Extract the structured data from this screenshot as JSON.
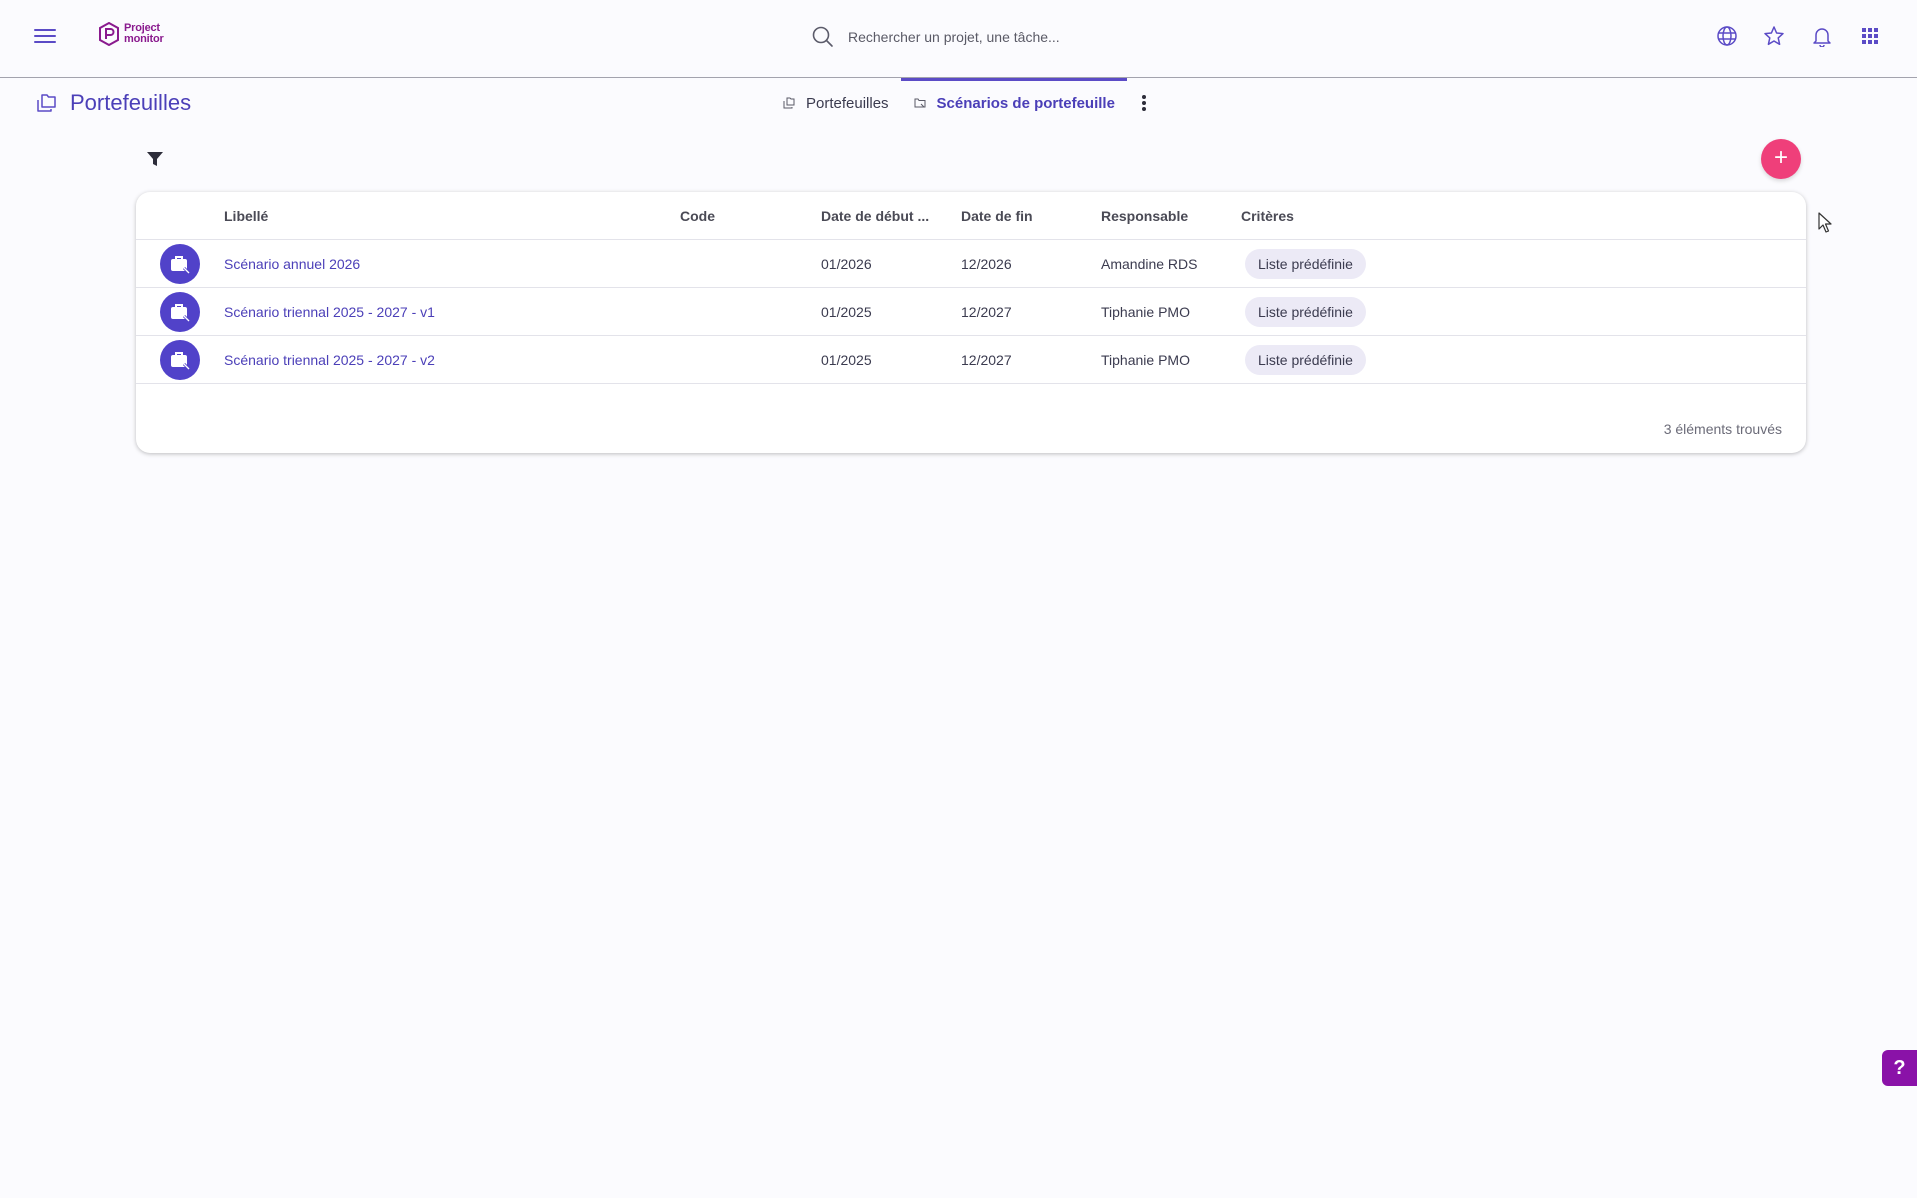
{
  "app": {
    "logo_line1": "Project",
    "logo_line2": "monitor"
  },
  "search": {
    "placeholder": "Rechercher un projet, une tâche..."
  },
  "topbar": {
    "icons": [
      "globe-icon",
      "star-icon",
      "bell-icon",
      "apps-grid-icon"
    ]
  },
  "page": {
    "title": "Portefeuilles"
  },
  "tabs": [
    {
      "label": "Portefeuilles",
      "active": false
    },
    {
      "label": "Scénarios de portefeuille",
      "active": true
    }
  ],
  "actions": {
    "add_label": "+"
  },
  "table": {
    "columns": [
      "Libellé",
      "Code",
      "Date de début ...",
      "Date de fin",
      "Responsable",
      "Critères"
    ],
    "rows": [
      {
        "label": "Scénario annuel 2026",
        "code": "",
        "start": "01/2026",
        "end": "12/2026",
        "owner": "Amandine RDS",
        "criteria": "Liste prédéfinie"
      },
      {
        "label": "Scénario triennal 2025 - 2027 - v1",
        "code": "",
        "start": "01/2025",
        "end": "12/2027",
        "owner": "Tiphanie PMO",
        "criteria": "Liste prédéfinie"
      },
      {
        "label": "Scénario triennal 2025 - 2027 - v2",
        "code": "",
        "start": "01/2025",
        "end": "12/2027",
        "owner": "Tiphanie PMO",
        "criteria": "Liste prédéfinie"
      }
    ],
    "count_text": "3 éléments trouvés"
  },
  "help": {
    "label": "?"
  },
  "colors": {
    "primary": "#5b4bc6",
    "accent": "#ef3f7a",
    "help": "#8a12a8"
  }
}
